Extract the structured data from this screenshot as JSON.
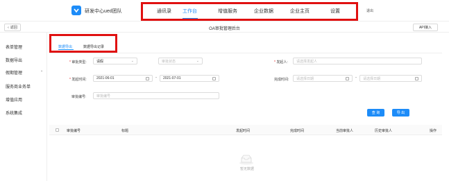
{
  "app": {
    "title": "研发中心ued团队"
  },
  "nav": {
    "items": [
      {
        "label": "通讯录"
      },
      {
        "label": "工作台"
      },
      {
        "label": "增值服务"
      },
      {
        "label": "企业数据"
      },
      {
        "label": "企业主页"
      },
      {
        "label": "设置"
      }
    ],
    "active": "工作台",
    "logout_label": "退出"
  },
  "subbar": {
    "back_label": "返回",
    "page_title": "OA审批管理后台",
    "api_label": "API接入"
  },
  "sidebar": {
    "items": [
      {
        "label": "表单管理"
      },
      {
        "label": "数据导出"
      },
      {
        "label": "假期管理"
      },
      {
        "label": "服务商业务单"
      },
      {
        "label": "增值应用"
      },
      {
        "label": "系统集成"
      }
    ]
  },
  "tabs": {
    "export": "数据导出",
    "records": "数据导出记录"
  },
  "form": {
    "approval_type_label": "审批类型:",
    "approval_type_value": "请假",
    "approval_status_placeholder": "审批状态",
    "initiator_label": "发起人:",
    "initiator_placeholder": "请选择发起人",
    "start_time_label": "发起时间:",
    "start_date_from": "2021-06-01",
    "start_date_to": "2021-07-01",
    "finish_time_label": "完成时间:",
    "finish_from_placeholder": "请选择日期",
    "finish_to_placeholder": "请选择日期",
    "approval_no_label": "审批编号:",
    "approval_no_placeholder": "审批编号",
    "range_separator": "-",
    "query_label": "查 询",
    "export_label": "导 出"
  },
  "table": {
    "columns": [
      "审批编号",
      "标题",
      "发起时间",
      "完成时间",
      "当前审批人",
      "历史审批人",
      "操作"
    ],
    "empty_text": "暂无数据"
  },
  "colors": {
    "accent": "#1d8cf8",
    "highlight_border": "#e01010"
  }
}
